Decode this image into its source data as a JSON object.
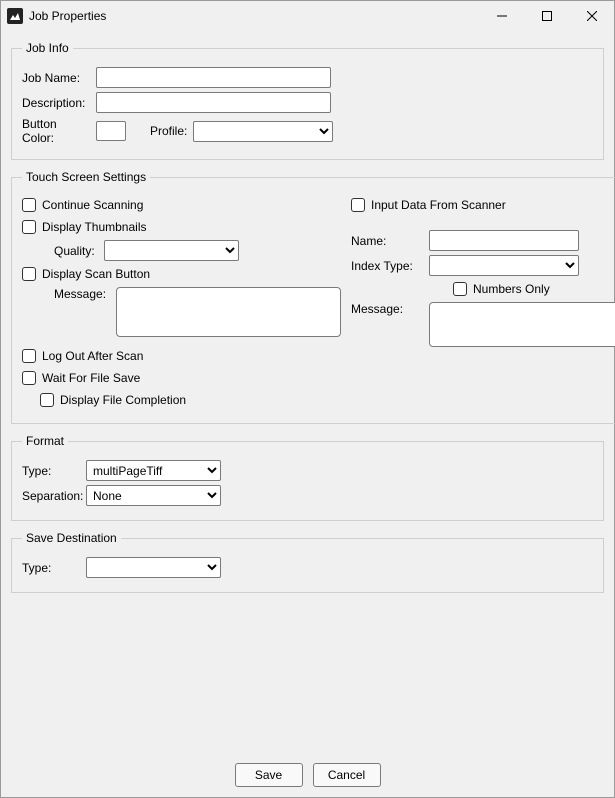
{
  "window": {
    "title": "Job Properties"
  },
  "job_info": {
    "legend": "Job Info",
    "name_label": "Job Name:",
    "name_value": "",
    "desc_label": "Description:",
    "desc_value": "",
    "btn_color_label": "Button Color:",
    "profile_label": "Profile:",
    "profile_value": ""
  },
  "touch": {
    "legend": "Touch Screen Settings",
    "continue_scanning": {
      "label": "Continue Scanning",
      "checked": false
    },
    "display_thumbnails": {
      "label": "Display Thumbnails",
      "checked": false
    },
    "quality_label": "Quality:",
    "quality_value": "",
    "display_scan_button": {
      "label": "Display Scan Button",
      "checked": false
    },
    "scan_message_label": "Message:",
    "scan_message_value": "",
    "logout_after_scan": {
      "label": "Log Out After Scan",
      "checked": false
    },
    "wait_for_file_save": {
      "label": "Wait For File Save",
      "checked": false
    },
    "display_file_completion": {
      "label": "Display File Completion",
      "checked": false
    },
    "input_data_from_scanner": {
      "label": "Input Data From Scanner",
      "checked": false
    },
    "idx_name_label": "Name:",
    "idx_name_value": "",
    "idx_type_label": "Index Type:",
    "idx_type_value": "",
    "numbers_only": {
      "label": "Numbers Only",
      "checked": false
    },
    "idx_message_label": "Message:",
    "idx_message_value": ""
  },
  "format": {
    "legend": "Format",
    "type_label": "Type:",
    "type_value": "multiPageTiff",
    "sep_label": "Separation:",
    "sep_value": "None"
  },
  "save_dest": {
    "legend": "Save Destination",
    "type_label": "Type:",
    "type_value": ""
  },
  "footer": {
    "save": "Save",
    "cancel": "Cancel"
  }
}
